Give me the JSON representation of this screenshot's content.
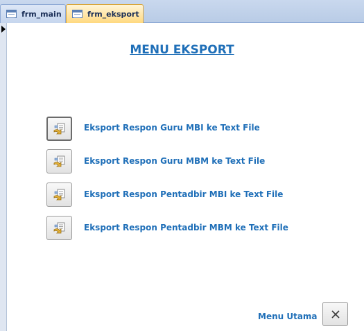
{
  "tabs": [
    {
      "label": "frm_main",
      "active": false
    },
    {
      "label": "frm_eksport",
      "active": true
    }
  ],
  "form": {
    "title": "MENU EKSPORT",
    "buttons": [
      {
        "label": "Eksport Respon Guru MBI ke Text File",
        "icon": "export-icon"
      },
      {
        "label": "Eksport Respon Guru MBM ke Text File",
        "icon": "export-icon"
      },
      {
        "label": "Eksport Respon Pentadbir MBI ke Text File",
        "icon": "export-icon"
      },
      {
        "label": "Eksport Respon Pentadbir MBM ke Text File",
        "icon": "export-icon"
      }
    ],
    "menu_utama_label": "Menu Utama",
    "close_icon": "close-icon"
  },
  "colors": {
    "accent_text": "#1f6fb8",
    "active_tab": "#ffd980",
    "tab_bar": "#c9d8ee"
  }
}
